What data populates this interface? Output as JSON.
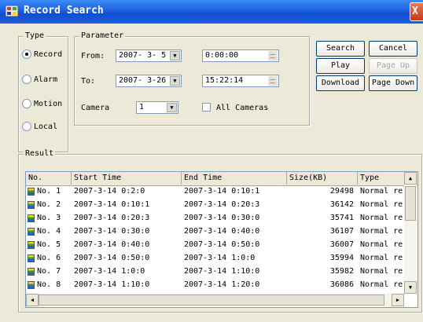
{
  "window": {
    "title": "Record Search",
    "close_glyph": "X"
  },
  "type_group": {
    "legend": "Type",
    "options": [
      {
        "label": "Record",
        "selected": true
      },
      {
        "label": "Alarm",
        "selected": false
      },
      {
        "label": "Motion",
        "selected": false
      },
      {
        "label": "Local",
        "selected": false
      }
    ]
  },
  "parameter_group": {
    "legend": "Parameter",
    "from_label": "From:",
    "from_date": "2007- 3- 5",
    "from_time": "0:00:00",
    "to_label": "To:",
    "to_date": "2007- 3-26",
    "to_time": "15:22:14",
    "camera_label": "Camera",
    "camera_value": "1",
    "all_cameras_label": "All Cameras",
    "all_cameras_checked": false
  },
  "buttons": {
    "search": "Search",
    "cancel": "Cancel",
    "play": "Play",
    "page_up": "Page Up",
    "download": "Download",
    "page_down": "Page Down"
  },
  "result": {
    "legend": "Result",
    "columns": [
      "No.",
      "Start Time",
      "End Time",
      "Size(KB)",
      "Type"
    ],
    "rows": [
      {
        "no": "No. 1",
        "start": "2007-3-14 0:2:0",
        "end": "2007-3-14 0:10:1",
        "size": "29498",
        "type": "Normal re"
      },
      {
        "no": "No. 2",
        "start": "2007-3-14 0:10:1",
        "end": "2007-3-14 0:20:3",
        "size": "36142",
        "type": "Normal re"
      },
      {
        "no": "No. 3",
        "start": "2007-3-14 0:20:3",
        "end": "2007-3-14 0:30:0",
        "size": "35741",
        "type": "Normal re"
      },
      {
        "no": "No. 4",
        "start": "2007-3-14 0:30:0",
        "end": "2007-3-14 0:40:0",
        "size": "36107",
        "type": "Normal re"
      },
      {
        "no": "No. 5",
        "start": "2007-3-14 0:40:0",
        "end": "2007-3-14 0:50:0",
        "size": "36007",
        "type": "Normal re"
      },
      {
        "no": "No. 6",
        "start": "2007-3-14 0:50:0",
        "end": "2007-3-14 1:0:0",
        "size": "35994",
        "type": "Normal re"
      },
      {
        "no": "No. 7",
        "start": "2007-3-14 1:0:0",
        "end": "2007-3-14 1:10:0",
        "size": "35982",
        "type": "Normal re"
      },
      {
        "no": "No. 8",
        "start": "2007-3-14 1:10:0",
        "end": "2007-3-14 1:20:0",
        "size": "36086",
        "type": "Normal re"
      }
    ]
  }
}
